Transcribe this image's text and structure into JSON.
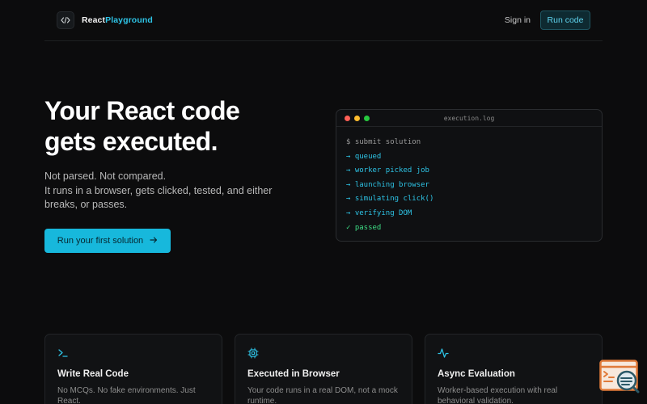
{
  "nav": {
    "brand_part1": "React",
    "brand_part2": "Playground",
    "logo_icon": "code-brackets-icon",
    "signin_label": "Sign in",
    "run_label": "Run code"
  },
  "hero": {
    "title_line1": "Your React code",
    "title_line2": "gets executed.",
    "subtitle_line1": "Not parsed. Not compared.",
    "subtitle_line2": "It runs in a browser, gets clicked, tested, and either",
    "subtitle_line3": "breaks, or passes.",
    "cta_label": "Run your first solution",
    "cta_icon": "arrow-right-icon"
  },
  "terminal": {
    "title": "execution.log",
    "lines": [
      {
        "prefix": "$",
        "text": "submit solution"
      },
      {
        "prefix": "→",
        "text": "queued"
      },
      {
        "prefix": "→",
        "text": "worker picked job"
      },
      {
        "prefix": "→",
        "text": "launching browser"
      },
      {
        "prefix": "→",
        "text": "simulating click()"
      },
      {
        "prefix": "→",
        "text": "verifying DOM"
      },
      {
        "prefix": "✓",
        "text": "passed"
      }
    ]
  },
  "features": [
    {
      "icon": "terminal-icon",
      "title": "Write Real Code",
      "desc": "No MCQs. No fake environments. Just React."
    },
    {
      "icon": "cpu-icon",
      "title": "Executed in Browser",
      "desc": "Your code runs in a real DOM, not a mock runtime."
    },
    {
      "icon": "activity-icon",
      "title": "Async Evaluation",
      "desc": "Worker-based execution with real behavioral validation."
    }
  ],
  "colors": {
    "background": "#0c0c0d",
    "accent": "#17b8dc",
    "success": "#3ddc84",
    "dot_red": "#ff5f56",
    "dot_yellow": "#ffbd2e",
    "dot_green": "#27c93f"
  }
}
